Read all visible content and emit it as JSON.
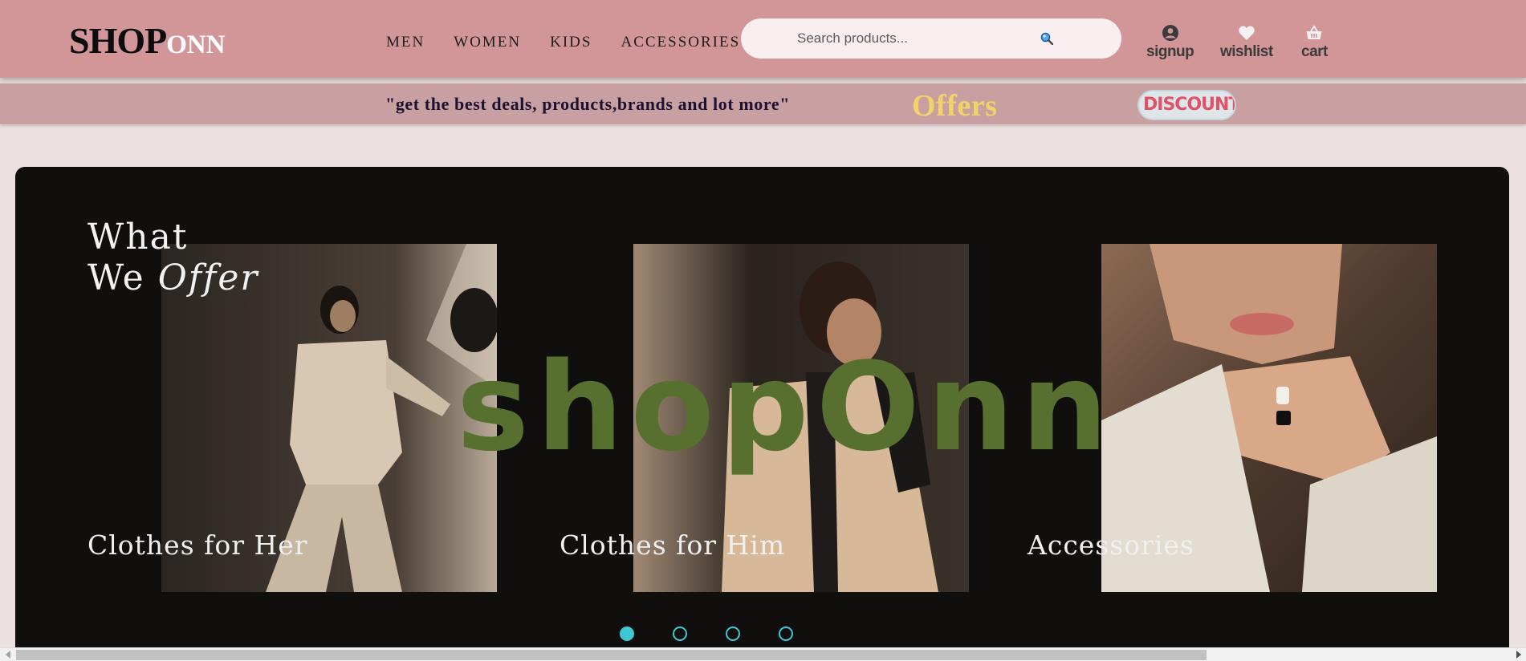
{
  "header": {
    "logo_big": "SHOP",
    "logo_small": "ONN",
    "nav": [
      {
        "label": "MEN"
      },
      {
        "label": "WOMEN"
      },
      {
        "label": "KIDS"
      },
      {
        "label": "ACCESSORIES"
      }
    ],
    "search": {
      "placeholder": "Search products...",
      "icon": "search-icon"
    },
    "actions": [
      {
        "label": "signup",
        "icon": "user-icon"
      },
      {
        "label": "wishlist",
        "icon": "heart-icon"
      },
      {
        "label": "cart",
        "icon": "basket-icon"
      }
    ],
    "colors": {
      "background": "#d29698"
    }
  },
  "promo": {
    "tagline": "\"get the best deals, products,brands and lot more\"",
    "offers": "Offers",
    "discounts": "DISCOUNTS",
    "colors": {
      "background": "#c9a0a2",
      "offers": "#f1d36a",
      "discounts": "#e05268"
    }
  },
  "banner": {
    "title_line1": "What",
    "title_line2_prefix": "We",
    "title_line2_italic": "Offer",
    "wordmark": "shopOnn",
    "captions": [
      "Clothes for Her",
      "Clothes for Him",
      "Accessories"
    ],
    "carousel": {
      "count": 4,
      "active_index": 0
    },
    "colors": {
      "background": "#110f0e",
      "wordmark": "#57702f",
      "dots": "#3ec8d4"
    }
  }
}
